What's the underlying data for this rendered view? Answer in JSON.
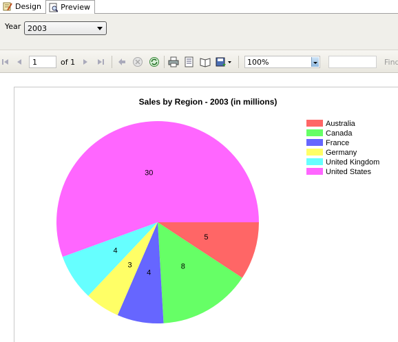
{
  "tabs": [
    {
      "label": "Design",
      "icon": "design-icon"
    },
    {
      "label": "Preview",
      "icon": "preview-icon",
      "active": true
    }
  ],
  "parameters": {
    "year_label": "Year",
    "year_value": "2003"
  },
  "toolbar": {
    "page_current": "1",
    "page_of_label": "of",
    "page_total": "1",
    "zoom_value": "100%",
    "find_label": "Find"
  },
  "chart_data": {
    "type": "pie",
    "title": "Sales by Region - 2003 (in millions)",
    "categories": [
      "Australia",
      "Canada",
      "France",
      "Germany",
      "United Kingdom",
      "United States"
    ],
    "values": [
      5,
      8,
      4,
      3,
      4,
      30
    ],
    "colors": [
      "#ff6666",
      "#66ff66",
      "#6666ff",
      "#ffff66",
      "#66ffff",
      "#ff66ff"
    ],
    "legend_position": "right",
    "start_angle_deg": 0,
    "direction": "clockwise"
  }
}
